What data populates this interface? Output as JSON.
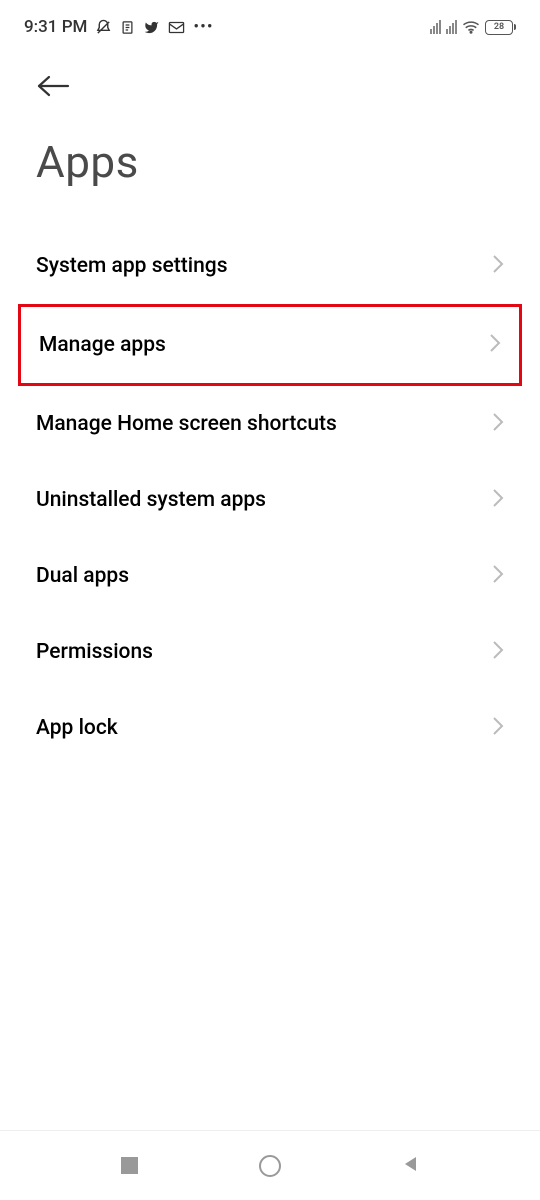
{
  "status": {
    "time": "9:31 PM",
    "battery": "28"
  },
  "header": {
    "title": "Apps"
  },
  "menu": {
    "items": [
      {
        "id": "system-app-settings",
        "label": "System app settings",
        "highlighted": false
      },
      {
        "id": "manage-apps",
        "label": "Manage apps",
        "highlighted": true
      },
      {
        "id": "manage-home-shortcuts",
        "label": "Manage Home screen shortcuts",
        "highlighted": false
      },
      {
        "id": "uninstalled-system-apps",
        "label": "Uninstalled system apps",
        "highlighted": false
      },
      {
        "id": "dual-apps",
        "label": "Dual apps",
        "highlighted": false
      },
      {
        "id": "permissions",
        "label": "Permissions",
        "highlighted": false
      },
      {
        "id": "app-lock",
        "label": "App lock",
        "highlighted": false
      }
    ]
  }
}
